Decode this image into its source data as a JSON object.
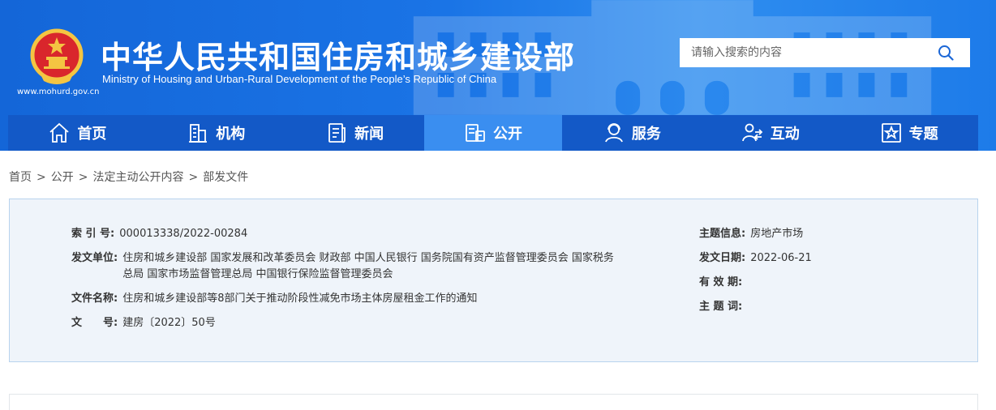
{
  "header": {
    "site_url": "www.mohurd.gov.cn",
    "title_cn": "中华人民共和国住房和城乡建设部",
    "title_en": "Ministry of Housing and Urban-Rural Development of the People’s Republic of China",
    "search": {
      "placeholder": "请输入搜索的内容"
    }
  },
  "nav": {
    "items": [
      {
        "label": "首页",
        "icon": "home-icon"
      },
      {
        "label": "机构",
        "icon": "building-icon"
      },
      {
        "label": "新闻",
        "icon": "news-icon"
      },
      {
        "label": "公开",
        "icon": "disclosure-icon",
        "active": true
      },
      {
        "label": "服务",
        "icon": "service-icon"
      },
      {
        "label": "互动",
        "icon": "interact-icon"
      },
      {
        "label": "专题",
        "icon": "topic-icon"
      }
    ]
  },
  "breadcrumb": {
    "items": [
      "首页",
      "公开",
      "法定主动公开内容",
      "部发文件"
    ],
    "separator": ">"
  },
  "info": {
    "index_label": "索 引 号:",
    "index_value": "000013338/2022-00284",
    "issuer_label": "发文单位:",
    "issuer_value": "住房和城乡建设部 国家发展和改革委员会 财政部 中国人民银行 国务院国有资产监督管理委员会 国家税务总局 国家市场监督管理总局 中国银行保险监督管理委员会",
    "filename_label": "文件名称:",
    "filename_value": "住房和城乡建设部等8部门关于推动阶段性减免市场主体房屋租金工作的通知",
    "docno_label": "文　　号:",
    "docno_value": "建房〔2022〕50号",
    "topic_label": "主题信息:",
    "topic_value": "房地产市场",
    "date_label": "发文日期:",
    "date_value": "2022-06-21",
    "validity_label": "有 效 期:",
    "validity_value": "",
    "keywords_label": "主 题 词:",
    "keywords_value": ""
  },
  "colors": {
    "header_blue": "#1a74e6",
    "nav_blue": "#1359c7",
    "nav_active": "#3a8ef0",
    "info_bg": "#eff4fa"
  }
}
